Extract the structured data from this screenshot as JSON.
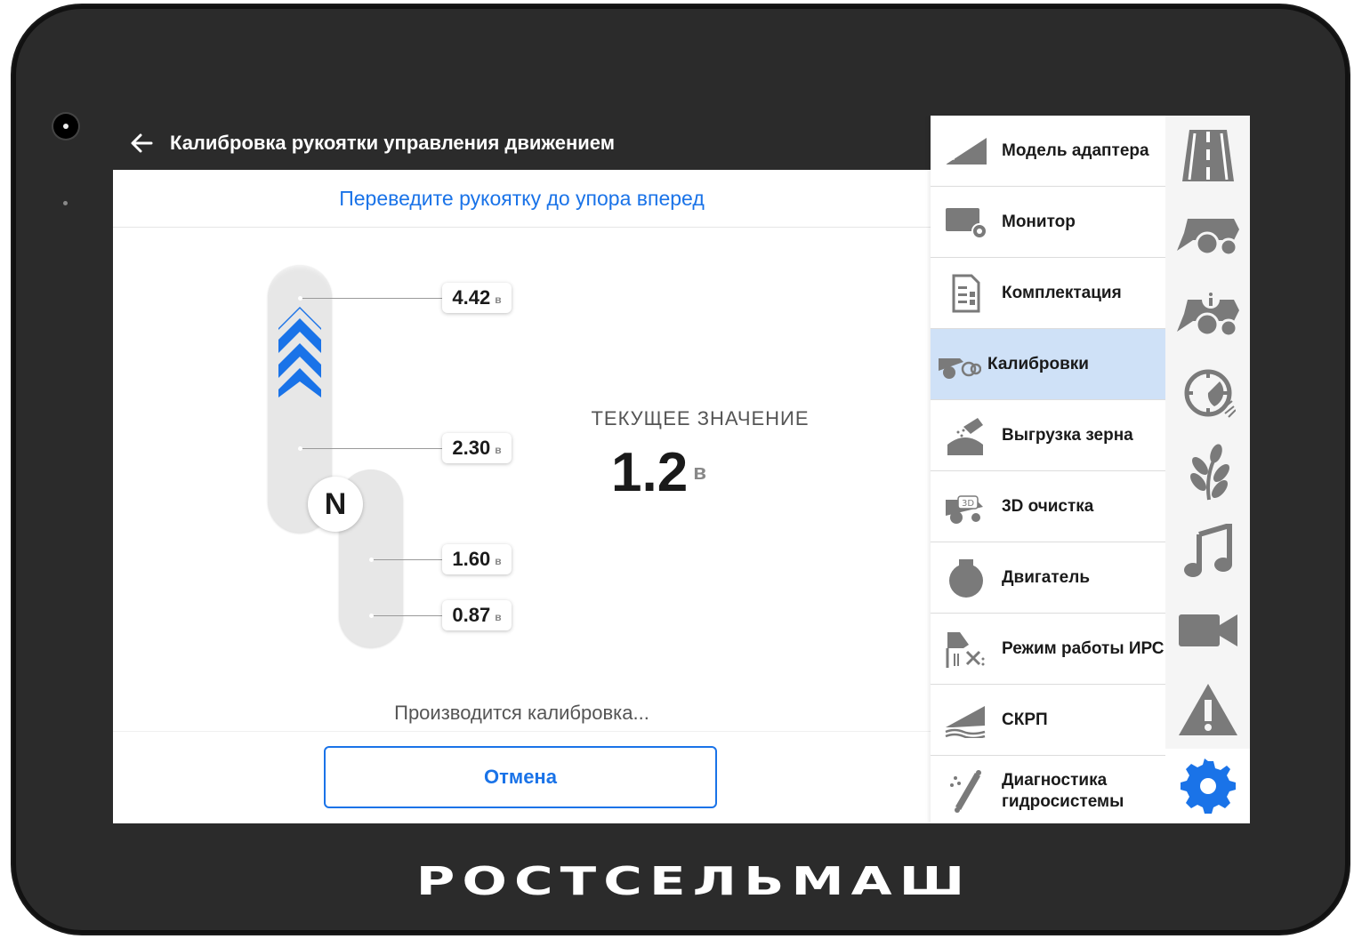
{
  "header": {
    "title": "Калибровка рукоятки управления движением"
  },
  "instruction": "Переведите рукоятку до упора вперед",
  "joystick": {
    "neutral_label": "N",
    "unit": "в",
    "points": [
      {
        "value": "4.42"
      },
      {
        "value": "2.30"
      },
      {
        "value": "1.60"
      },
      {
        "value": "0.87"
      }
    ]
  },
  "current": {
    "label": "ТЕКУЩЕЕ ЗНАЧЕНИЕ",
    "value": "1.2",
    "unit": "в"
  },
  "status": "Производится калибровка...",
  "cancel_label": "Отмена",
  "menu": {
    "items": [
      {
        "label": "Модель адаптера",
        "icon": "adapter-icon"
      },
      {
        "label": "Монитор",
        "icon": "monitor-icon"
      },
      {
        "label": "Комплектация",
        "icon": "configuration-icon"
      },
      {
        "label": "Калибровки",
        "icon": "calibration-icon",
        "active": true
      },
      {
        "label": "Выгрузка зерна",
        "icon": "grain-unload-icon"
      },
      {
        "label": "3D очистка",
        "icon": "3d-cleaning-icon"
      },
      {
        "label": "Двигатель",
        "icon": "engine-icon"
      },
      {
        "label": "Режим работы ИРС",
        "icon": "irs-mode-icon"
      },
      {
        "label": "СКРП",
        "icon": "skrp-icon"
      },
      {
        "label": "Диагностика гидросистемы",
        "icon": "hydraulics-icon"
      }
    ]
  },
  "rail": [
    "road-icon",
    "combine-icon",
    "combine-info-icon",
    "gauge-icon",
    "crop-icon",
    "music-icon",
    "camera-icon",
    "warning-icon",
    "settings-icon"
  ],
  "colors": {
    "accent": "#1a73e8",
    "header": "#2b2b2b",
    "active_row": "#cfe1f7",
    "icon_gray": "#7a7a7a"
  },
  "brand": "РОСТСЕЛЬМАШ"
}
